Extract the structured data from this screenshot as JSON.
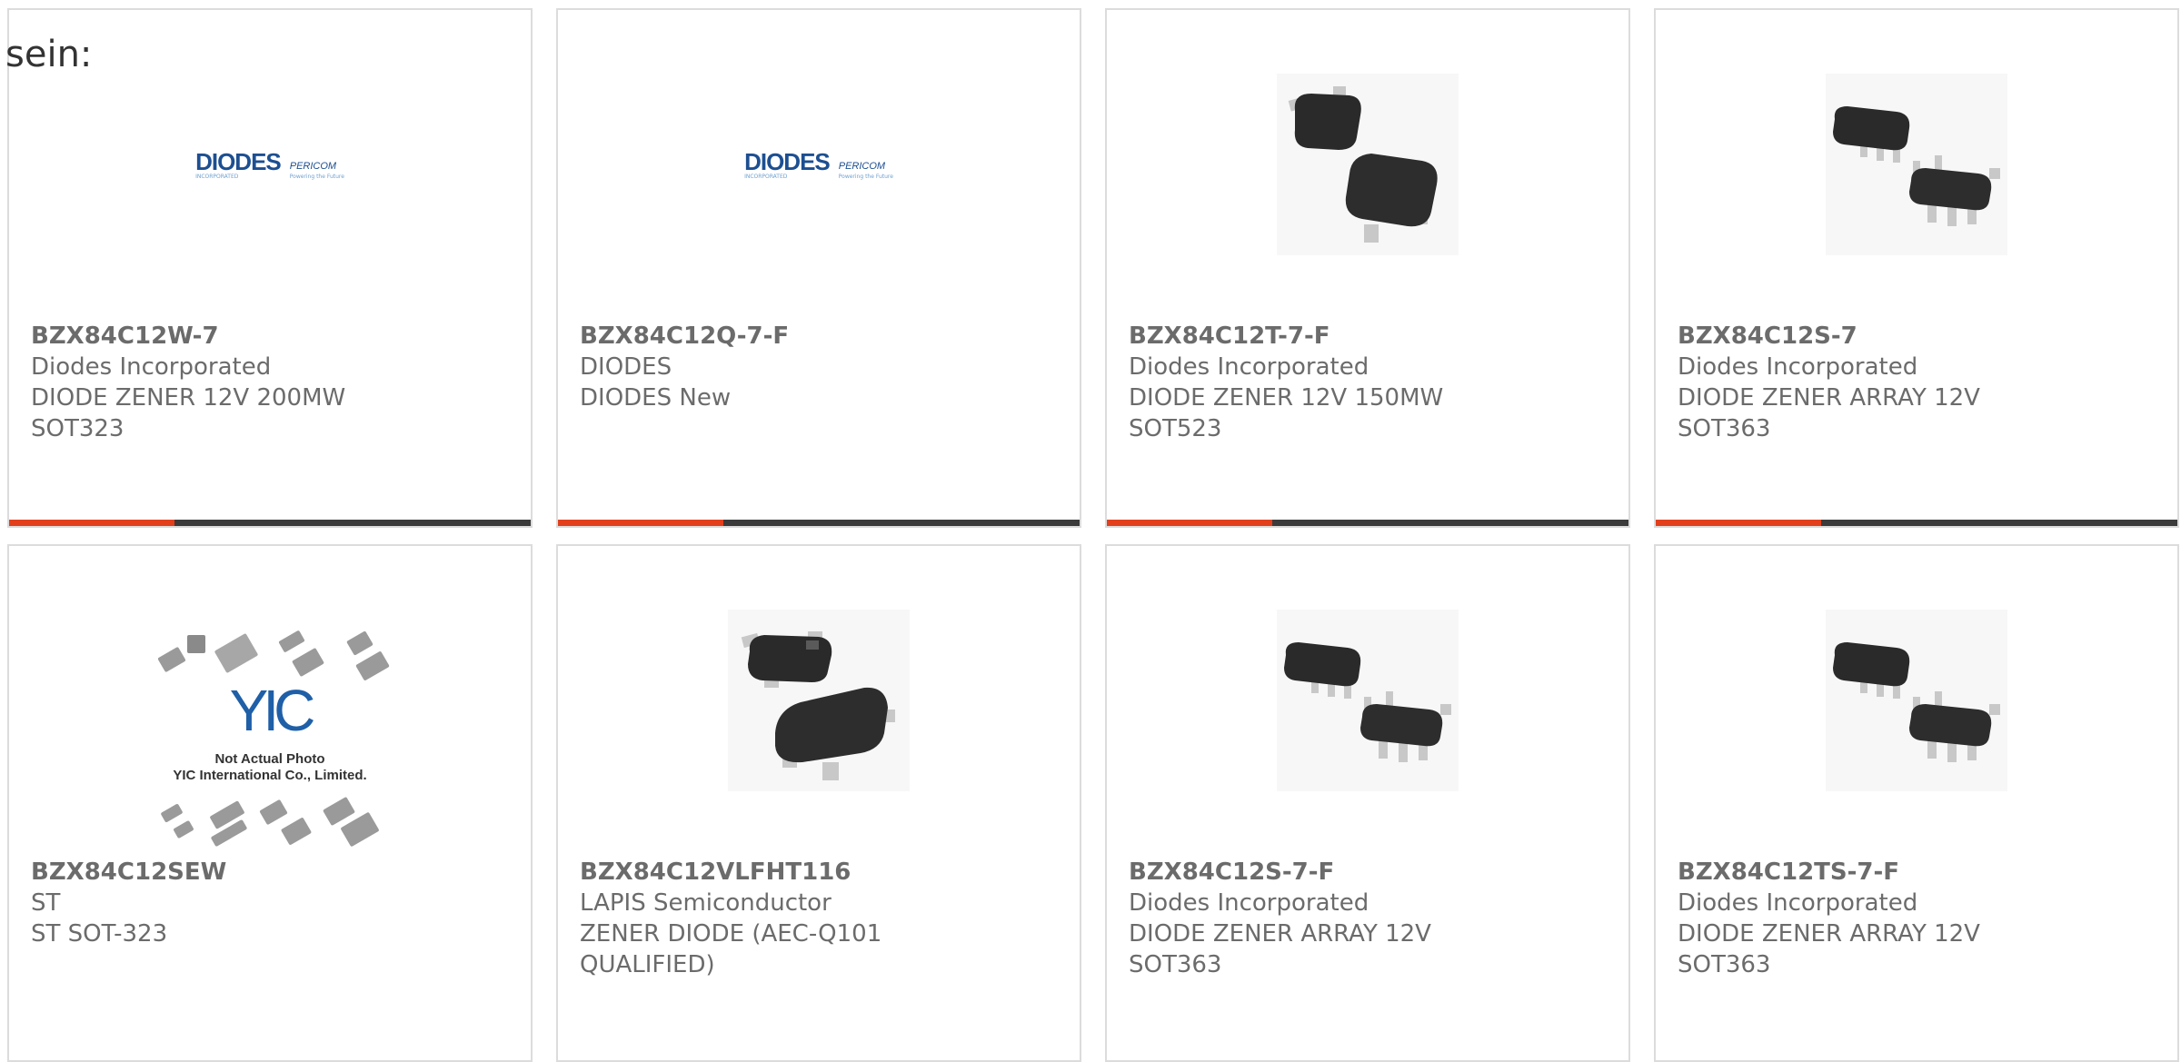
{
  "intro_text": "sein:",
  "products": [
    {
      "part": "BZX84C12W-7",
      "lines": [
        "Diodes Incorporated",
        "DIODE ZENER 12V 200MW",
        "SOT323"
      ],
      "image": "diodes-logo",
      "bar": true
    },
    {
      "part": "BZX84C12Q-7-F",
      "lines": [
        "DIODES",
        "DIODES New"
      ],
      "image": "diodes-logo",
      "bar": true
    },
    {
      "part": "BZX84C12T-7-F",
      "lines": [
        "Diodes Incorporated",
        "DIODE ZENER 12V 150MW",
        "SOT523"
      ],
      "image": "sot523-package",
      "bar": true
    },
    {
      "part": "BZX84C12S-7",
      "lines": [
        "Diodes Incorporated",
        "DIODE ZENER ARRAY 12V",
        "SOT363"
      ],
      "image": "sot363-package",
      "bar": true
    },
    {
      "part": "BZX84C12SEW",
      "lines": [
        "ST",
        "ST SOT-323"
      ],
      "image": "yic-placeholder",
      "bar": false
    },
    {
      "part": "BZX84C12VLFHT116",
      "lines": [
        "LAPIS Semiconductor",
        "ZENER DIODE (AEC-Q101",
        "QUALIFIED)"
      ],
      "image": "sot-package",
      "bar": false
    },
    {
      "part": "BZX84C12S-7-F",
      "lines": [
        "Diodes Incorporated",
        "DIODE ZENER ARRAY 12V",
        "SOT363"
      ],
      "image": "sot363-package",
      "bar": false
    },
    {
      "part": "BZX84C12TS-7-F",
      "lines": [
        "Diodes Incorporated",
        "DIODE ZENER ARRAY 12V",
        "SOT363"
      ],
      "image": "sot363-package",
      "bar": false
    }
  ],
  "diodes_logo": {
    "brand": "DIODES",
    "sub": "INCORPORATED",
    "partner": "PERICOM",
    "partner_sub": "Powering the Future"
  },
  "yic": {
    "logo": "YIC",
    "note_1": "Not Actual Photo",
    "note_2": "YIC International Co., Limited."
  },
  "colors": {
    "accent": "#e2401c",
    "bar": "#3b3b3b",
    "border": "#dcdcdc",
    "text": "#6b6b6b",
    "brand_blue": "#1d4f91"
  }
}
